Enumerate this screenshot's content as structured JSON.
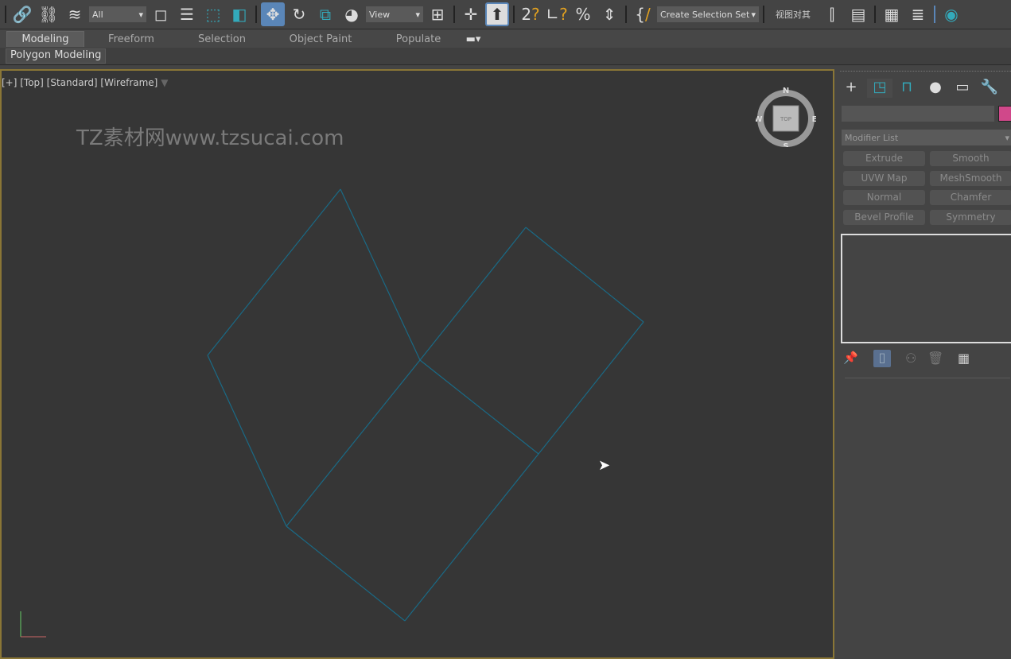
{
  "toolbar": {
    "selection_filter": "All",
    "reference_coord": "View",
    "named_selection": "Create Selection Set",
    "align_label": "视图对其",
    "icons": [
      "link-icon",
      "unlink-icon",
      "bind-space-warp-icon",
      "select-object-icon",
      "select-by-name-icon",
      "rect-selection-icon",
      "window-crossing-icon",
      "move-icon",
      "rotate-icon",
      "scale-icon",
      "placement-icon",
      "pivot-icon",
      "manipulate-icon",
      "keyboard-shortcut-icon",
      "snap-2.5-icon",
      "angle-snap-icon",
      "percent-snap-icon",
      "spinner-snap-icon",
      "edit-named-sets-icon",
      "mirror-icon",
      "align-icon",
      "scene-explorer-icon",
      "layer-explorer-icon"
    ],
    "active": "move-icon"
  },
  "ribbon": {
    "tabs": [
      "Modeling",
      "Freeform",
      "Selection",
      "Object Paint",
      "Populate"
    ],
    "selected": "Modeling",
    "sub_panel": "Polygon Modeling"
  },
  "viewport": {
    "label": "[+] [Top] [Standard] [Wireframe]",
    "watermark": "TZ素材网www.tzsucai.com",
    "viewcube": {
      "face": "TOP",
      "n": "N",
      "s": "S",
      "e": "E",
      "w": "W"
    },
    "wire_color": "#1a6a86"
  },
  "command_panel": {
    "tabs": [
      "create-icon",
      "modify-icon",
      "hierarchy-icon",
      "motion-icon",
      "display-icon",
      "utilities-icon"
    ],
    "active_tab": "modify-icon",
    "object_color": "#d0488a",
    "modifier_list": "Modifier List",
    "modifier_buttons": [
      "Extrude",
      "Smooth",
      "UVW Map",
      "MeshSmooth",
      "Normal",
      "Chamfer",
      "Bevel Profile",
      "Symmetry"
    ]
  }
}
